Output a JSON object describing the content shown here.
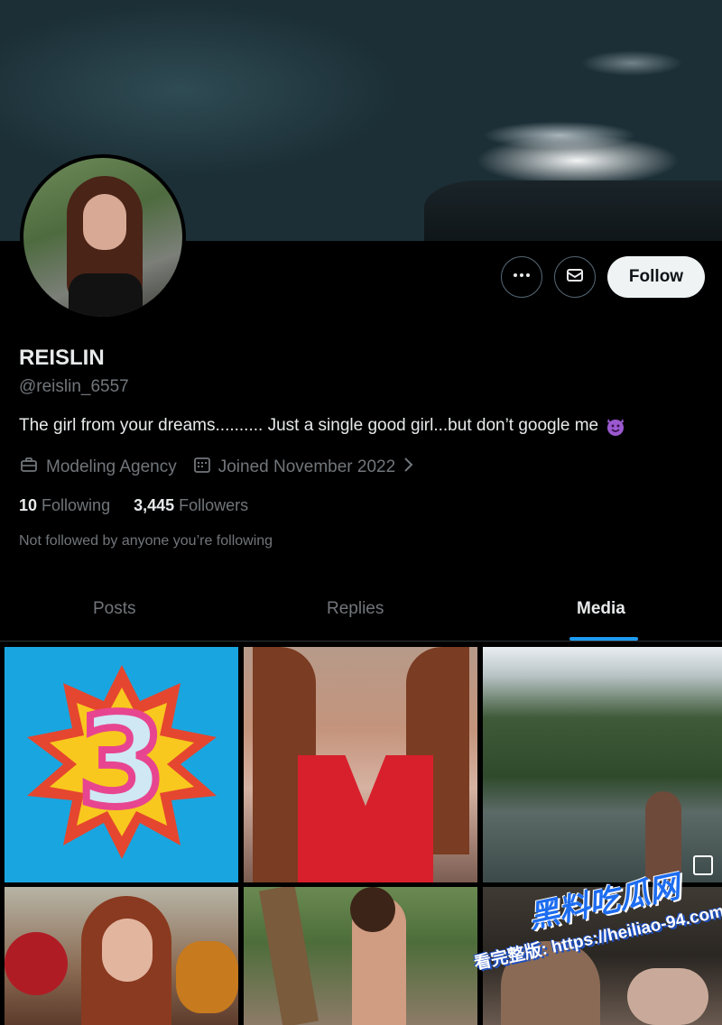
{
  "profile": {
    "name": "REISLIN",
    "handle": "@reislin_6557",
    "bio": "The girl from your dreams.......... Just a single good girl...but don’t google me",
    "bio_emoji": "smiling-devil-emoji",
    "category": "Modeling Agency",
    "joined": "Joined November 2022",
    "following_count": "10",
    "following_label": "Following",
    "followers_count": "3,445",
    "followers_label": "Followers",
    "not_followed": "Not followed by anyone you’re following"
  },
  "actions": {
    "more_icon": "more-horizontal-icon",
    "message_icon": "envelope-icon",
    "follow_label": "Follow"
  },
  "tabs": [
    {
      "label": "Posts"
    },
    {
      "label": "Replies"
    },
    {
      "label": "Media"
    }
  ],
  "active_tab": "Media",
  "media": [
    {
      "desc": "number-3-starburst"
    },
    {
      "desc": "red-top-photo"
    },
    {
      "desc": "mountain-lake-photo"
    },
    {
      "desc": "flowers-portrait-photo"
    },
    {
      "desc": "tropical-photo"
    },
    {
      "desc": "dark-photo"
    }
  ],
  "watermark": {
    "line1": "黑料吃瓜网",
    "line2": "看完整版: https://heiliao-94.com"
  },
  "colors": {
    "accent": "#1d9bf0",
    "muted": "#71767b",
    "text": "#e7e9ea"
  }
}
